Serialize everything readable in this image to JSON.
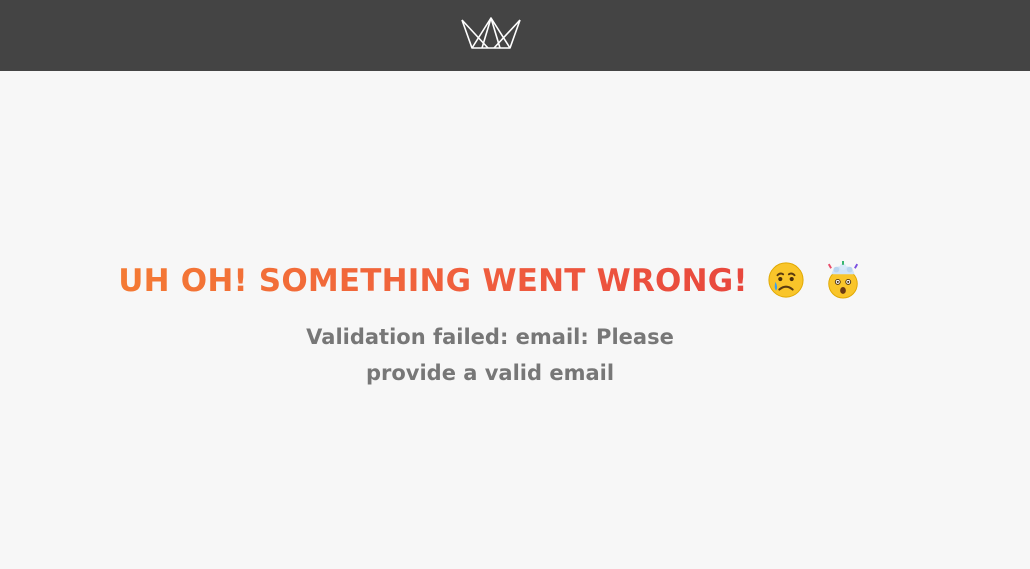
{
  "header": {
    "logo_icon": "crown-icon",
    "background": "#444444"
  },
  "error": {
    "title": "UH OH! SOMETHING WENT WRONG!",
    "emojis": [
      "crying-face-emoji",
      "exploding-head-emoji"
    ],
    "message": "Validation failed: email: Please provide a valid email"
  },
  "colors": {
    "title_start": "#f47a34",
    "title_end": "#e8473d",
    "message": "#777777",
    "page_background": "#f7f7f7"
  }
}
